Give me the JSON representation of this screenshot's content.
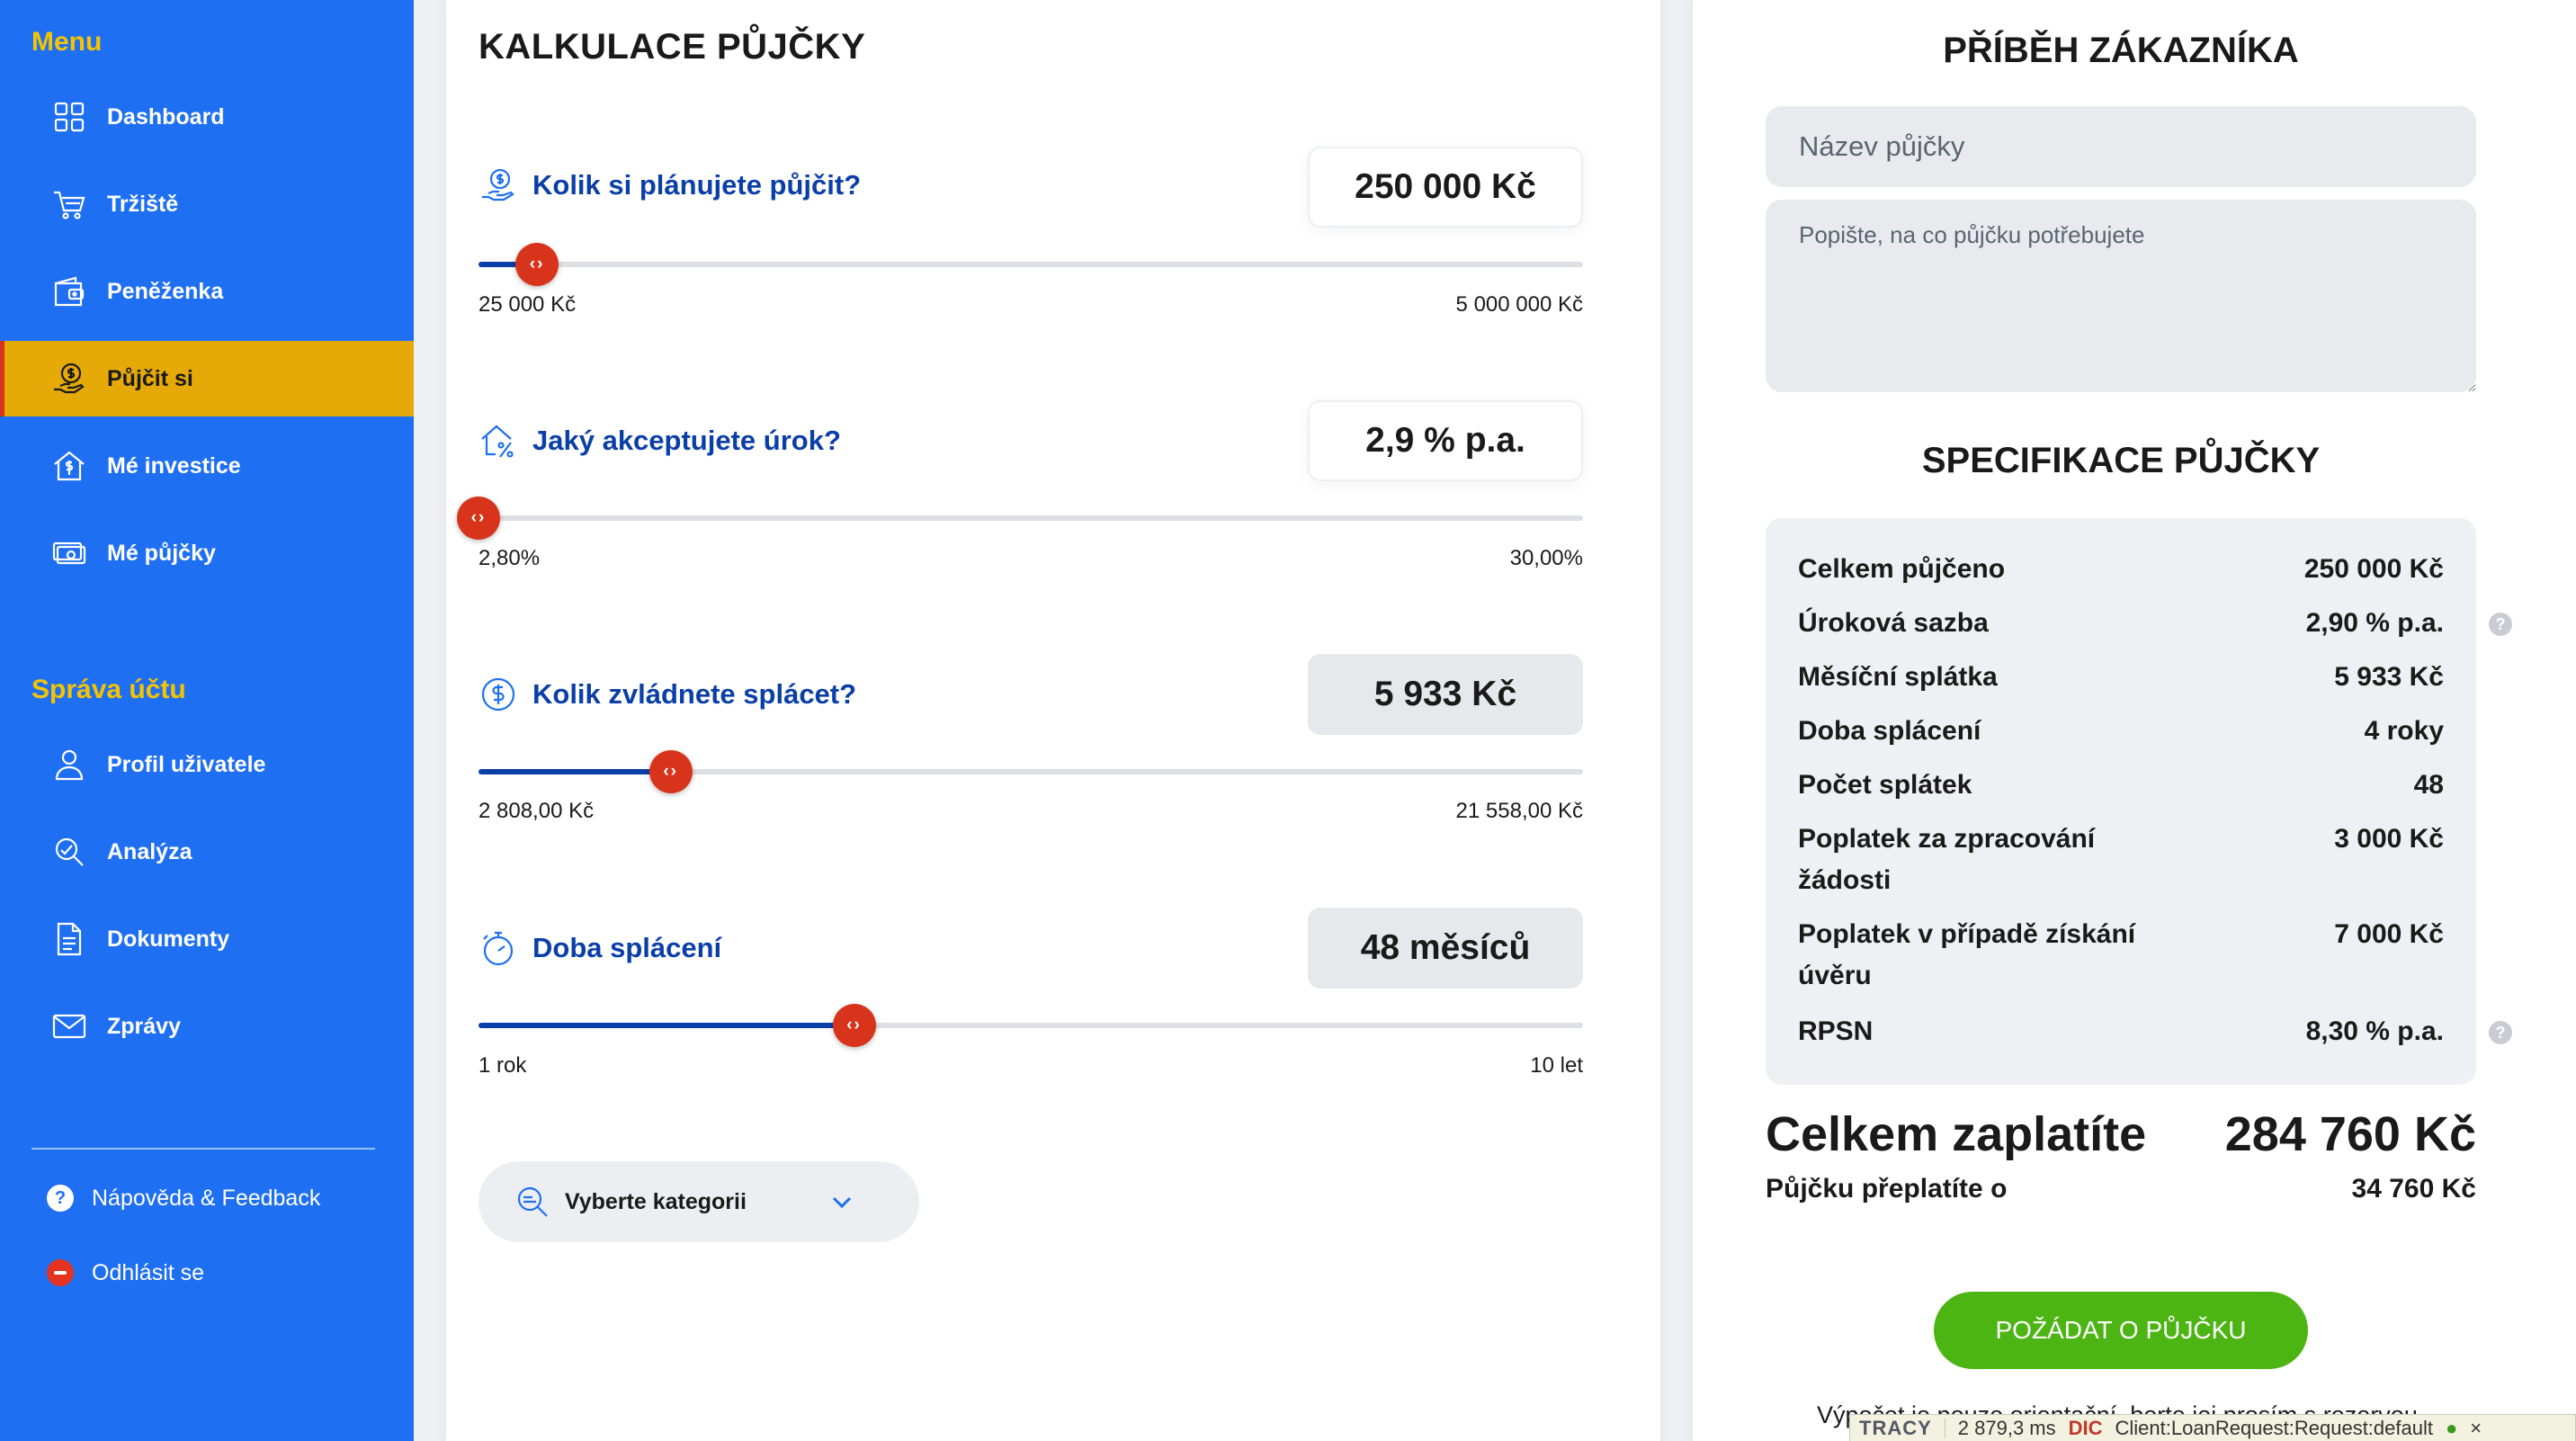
{
  "sidebar": {
    "menu_heading": "Menu",
    "items": [
      {
        "label": "Dashboard",
        "icon": "dashboard-icon"
      },
      {
        "label": "Tržiště",
        "icon": "cart-icon"
      },
      {
        "label": "Peněženka",
        "icon": "wallet-icon"
      },
      {
        "label": "Půjčit si",
        "icon": "coin-hand-icon",
        "active": true
      },
      {
        "label": "Mé investice",
        "icon": "house-dollar-icon"
      },
      {
        "label": "Mé půjčky",
        "icon": "cash-icon"
      }
    ],
    "account_heading": "Správa účtu",
    "account_items": [
      {
        "label": "Profil uživatele",
        "icon": "user-icon"
      },
      {
        "label": "Analýza",
        "icon": "analysis-icon"
      },
      {
        "label": "Dokumenty",
        "icon": "document-icon"
      },
      {
        "label": "Zprávy",
        "icon": "mail-icon"
      }
    ],
    "help_label": "Nápověda & Feedback",
    "logout_label": "Odhlásit se"
  },
  "calculator": {
    "title": "KALKULACE PŮJČKY",
    "sliders": [
      {
        "label": "Kolik si plánujete půjčit?",
        "value": "250 000 Kč",
        "min": "25 000 Kč",
        "max": "5 000 000 Kč",
        "position": 0.053,
        "editable": true
      },
      {
        "label": "Jaký akceptujete úrok?",
        "value": "2,9 % p.a.",
        "min": "2,80%",
        "max": "30,00%",
        "position": 0.0,
        "editable": true
      },
      {
        "label": "Kolik zvládnete splácet?",
        "value": "5 933 Kč",
        "min": "2 808,00 Kč",
        "max": "21 558,00 Kč",
        "position": 0.174,
        "editable": false
      },
      {
        "label": "Doba splácení",
        "value": "48 měsíců",
        "min": "1 rok",
        "max": "10 let",
        "position": 0.34,
        "editable": false
      }
    ],
    "category_placeholder": "Vyberte kategorii"
  },
  "story": {
    "title": "PŘÍBĚH ZÁKAZNÍKA",
    "name_placeholder": "Název půjčky",
    "description_placeholder": "Popište, na co půjčku potřebujete"
  },
  "spec": {
    "title": "SPECIFIKACE PŮJČKY",
    "rows": [
      {
        "label": "Celkem půjčeno",
        "value": "250 000 Kč"
      },
      {
        "label": "Úroková sazba",
        "value": "2,90 % p.a.",
        "help": true
      },
      {
        "label": "Měsíční splátka",
        "value": "5 933 Kč"
      },
      {
        "label": "Doba splácení",
        "value": "4 roky"
      },
      {
        "label": "Počet splátek",
        "value": "48"
      },
      {
        "label": "Poplatek za zpracování žádosti",
        "value": "3 000 Kč"
      },
      {
        "label": "Poplatek v případě získání úvěru",
        "value": "7 000 Kč"
      },
      {
        "label": "RPSN",
        "value": "8,30 % p.a.",
        "help": true
      }
    ],
    "total_label": "Celkem zaplatíte",
    "total_value": "284 760 Kč",
    "overpay_label": "Půjčku přeplatíte o",
    "overpay_value": "34 760 Kč",
    "cta_label": "POŽÁDAT O PŮJČKU",
    "disclaimer": "Výpočet je pouze orientační, berte jej prosím s rezervou."
  },
  "tracy": {
    "label": "TRACY",
    "time": "2 879,3 ms",
    "di": "DIC",
    "request": "Client:LoanRequest:Request:default",
    "close": "×"
  },
  "colors": {
    "sidebar_bg": "#1f6ff2",
    "heading_yellow": "#f5c400",
    "active_bg": "#e5a908",
    "thumb_red": "#d8341b",
    "track_blue": "#0b3fa8",
    "cta_green": "#4cb514"
  }
}
